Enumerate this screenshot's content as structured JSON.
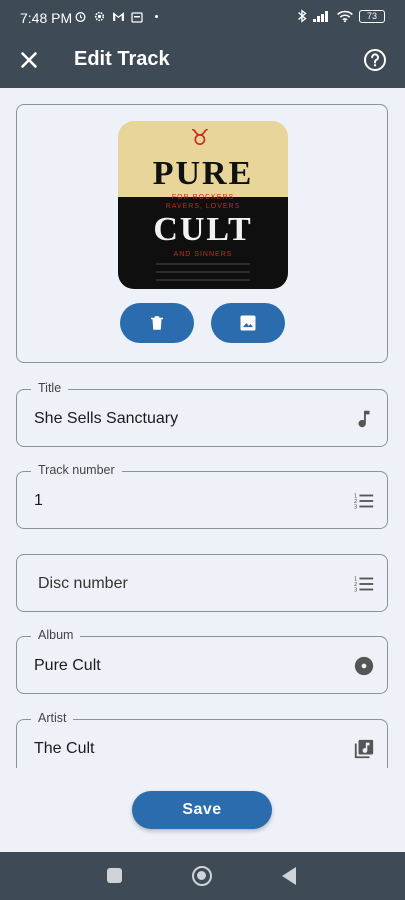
{
  "status_bar": {
    "time": "7:48 PM",
    "battery": "73",
    "left_icons": [
      "alarm-icon",
      "settings-icon",
      "gmail-icon",
      "calendar-icon",
      "dot-icon"
    ],
    "right_icons": [
      "bluetooth-icon",
      "signal-icon",
      "wifi-icon",
      "battery-icon"
    ]
  },
  "app_bar": {
    "title": "Edit Track",
    "close_icon": "close-icon",
    "help_icon": "help-icon"
  },
  "artwork": {
    "cover_text": {
      "line1": "PURE",
      "tag1": "FOR ROCKERS",
      "tag2": "RAVERS, LOVERS",
      "line2": "CULT",
      "tag3": "AND SINNERS"
    },
    "delete_icon": "trash-icon",
    "change_icon": "image-icon"
  },
  "fields": {
    "title": {
      "label": "Title",
      "value": "She Sells Sanctuary",
      "icon": "music-note-icon"
    },
    "track_number": {
      "label": "Track number",
      "value": "1",
      "icon": "numbered-list-icon"
    },
    "disc_number": {
      "placeholder": "Disc number",
      "icon": "numbered-list-icon"
    },
    "album": {
      "label": "Album",
      "value": "Pure Cult",
      "icon": "album-icon"
    },
    "artist": {
      "label": "Artist",
      "value": "The Cult",
      "icon": "artist-icon"
    }
  },
  "actions": {
    "save_label": "Save"
  },
  "colors": {
    "bar": "#3e4a55",
    "background": "#eef2f8",
    "accent": "#2a6cad"
  }
}
